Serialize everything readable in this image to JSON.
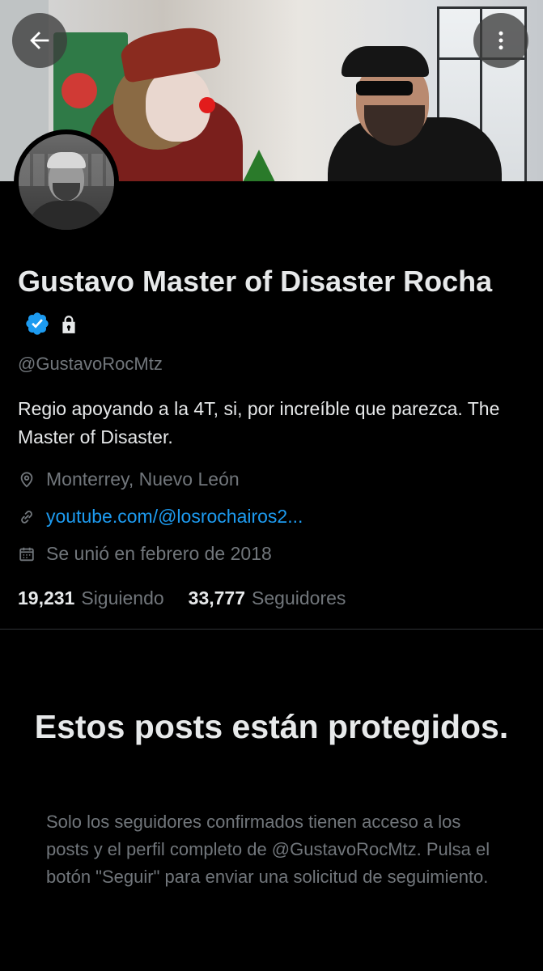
{
  "profile": {
    "name": "Gustavo Master of Disaster Rocha",
    "handle": "@GustavoRocMtz",
    "bio": "Regio apoyando a la 4T, si, por increíble que parezca. The Master of Disaster.",
    "location": "Monterrey, Nuevo León",
    "link": "youtube.com/@losrochairos2...",
    "joined": "Se unió en febrero de 2018",
    "verified": true,
    "protected": true
  },
  "stats": {
    "following_count": "19,231",
    "following_label": "Siguiendo",
    "followers_count": "33,777",
    "followers_label": "Seguidores"
  },
  "protected_notice": {
    "title": "Estos posts están protegidos.",
    "description": "Solo los seguidores confirmados tienen acceso a los posts y el perfil completo de @GustavoRocMtz. Pulsa el botón \"Seguir\" para enviar una solicitud de seguimiento."
  },
  "icons": {
    "back": "arrow-left-icon",
    "more": "more-vertical-icon",
    "verified": "verified-badge-icon",
    "lock": "lock-icon",
    "location": "location-pin-icon",
    "link": "link-icon",
    "calendar": "calendar-icon"
  },
  "colors": {
    "background": "#000000",
    "text_primary": "#e7e9ea",
    "text_secondary": "#71767b",
    "accent": "#1d9bf0"
  }
}
